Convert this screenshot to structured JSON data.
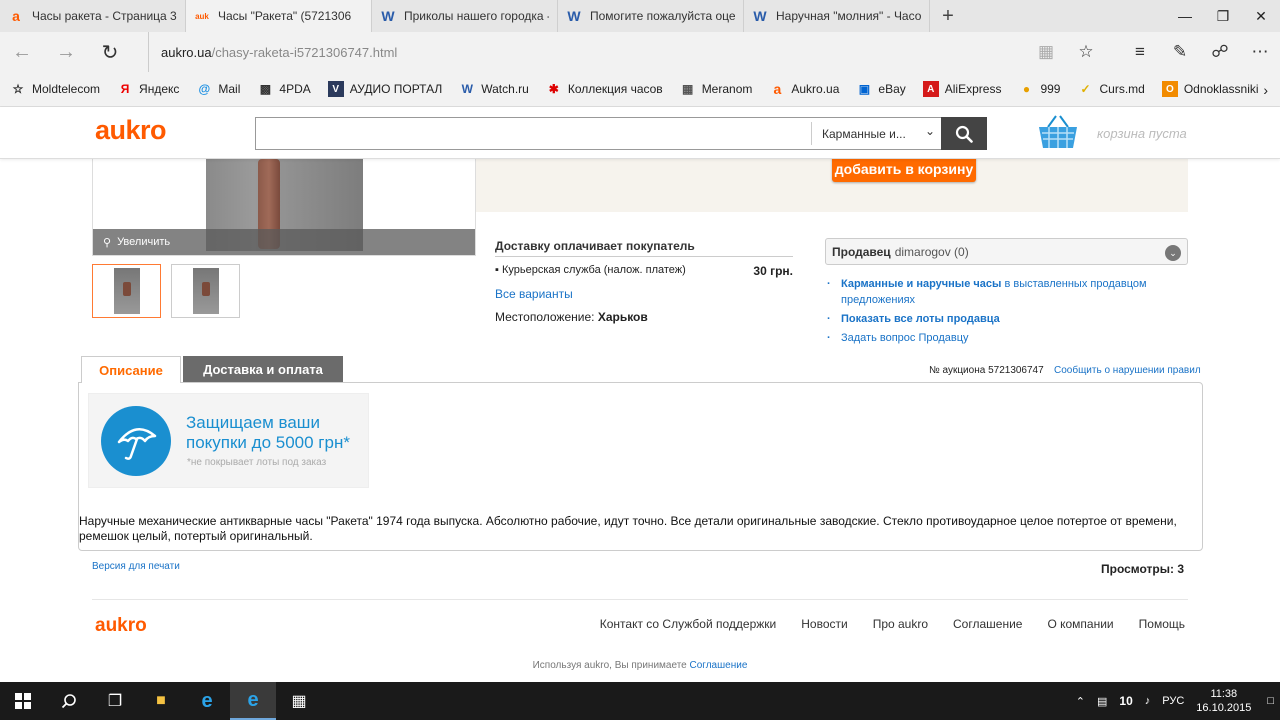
{
  "browser": {
    "tabs": [
      {
        "label": "Часы ракета - Страница 3 -",
        "icon": "aukro-favicon-icon",
        "active": false
      },
      {
        "label": "Часы \"Ракета\" (5721306",
        "icon": "aukro-small-favicon-icon",
        "active": true
      },
      {
        "label": "Приколы нашего городка -",
        "icon": "w-favicon-icon",
        "active": false
      },
      {
        "label": "Помогите пожалуйста оцен",
        "icon": "w-favicon-icon",
        "active": false
      },
      {
        "label": "Наручная \"молния\" - Часов",
        "icon": "w-favicon-icon",
        "active": false
      }
    ],
    "url_host": "aukro.ua",
    "url_path": "/chasy-raketa-i5721306747.html",
    "favorites": [
      {
        "label": "Moldtelecom",
        "icon": "star-icon"
      },
      {
        "label": "Яндекс",
        "icon": "yandex-icon"
      },
      {
        "label": "Mail",
        "icon": "mail-icon"
      },
      {
        "label": "4PDA",
        "icon": "4pda-icon"
      },
      {
        "label": "АУДИО ПОРТАЛ",
        "icon": "audio-portal-icon"
      },
      {
        "label": "Watch.ru",
        "icon": "w-icon"
      },
      {
        "label": "Коллекция часов",
        "icon": "red-star-icon"
      },
      {
        "label": "Meranom",
        "icon": "cart-icon"
      },
      {
        "label": "Aukro.ua",
        "icon": "aukro-icon"
      },
      {
        "label": "eBay",
        "icon": "ebay-icon"
      },
      {
        "label": "AliExpress",
        "icon": "aliexpress-icon"
      },
      {
        "label": "999",
        "icon": "999-icon"
      },
      {
        "label": "Curs.md",
        "icon": "curs-icon"
      },
      {
        "label": "Odnoklassniki",
        "icon": "odnoklassniki-icon"
      }
    ]
  },
  "site": {
    "logo": "aukro",
    "search_value": "",
    "search_category": "Карманные и...",
    "cart_text": "корзина пуста"
  },
  "product": {
    "zoom_label": "Увеличить",
    "add_to_cart": "добавить в корзину",
    "delivery_title": "Доставку оплачивает покупатель",
    "delivery_method": "Курьерская служба (налож. платеж)",
    "delivery_price": "30 грн.",
    "all_options": "Все варианты",
    "location_label": "Местоположение:",
    "location_value": "Харьков"
  },
  "seller": {
    "label": "Продавец",
    "name": "dimarogov (0)",
    "link1_bold": "Карманные и наручные часы",
    "link1_rest": " в выставленных продавцом предложениях",
    "link2": "Показать все лоты продавца",
    "link3": "Задать вопрос Продавцу"
  },
  "tabs": {
    "description": "Описание",
    "delivery": "Доставка и оплата",
    "auction_no": "№ аукциона 5721306747",
    "report": "Сообщить о нарушении правил"
  },
  "description": {
    "protect_title_1": "Защищаем ваши",
    "protect_title_2": "покупки до 5000 грн*",
    "protect_note": "*не покрывает лоты под заказ",
    "text": "Наручные механические антикварные часы \"Ракета\" 1974 года выпуска. Абсолютно рабочие, идут точно. Все детали оригинальные заводские. Стекло противоударное целое потертое от времени, ремешок целый, потертый оригинальный."
  },
  "page_footer": {
    "print_version": "Версия для печати",
    "views": "Просмотры: 3",
    "logo": "aukro",
    "links": [
      "Контакт со Службой поддержки",
      "Новости",
      "Про aukro",
      "Соглашение",
      "О компании",
      "Помощь"
    ],
    "agree_prefix": "Используя aukro, Вы принимаете",
    "agree_link": "Соглашение"
  },
  "taskbar": {
    "lang": "РУС",
    "time": "11:38",
    "date": "16.10.2015",
    "badge": "10"
  },
  "colors": {
    "brand": "#ff5a00",
    "link": "#1a73c7",
    "protect": "#1a8fd0"
  }
}
